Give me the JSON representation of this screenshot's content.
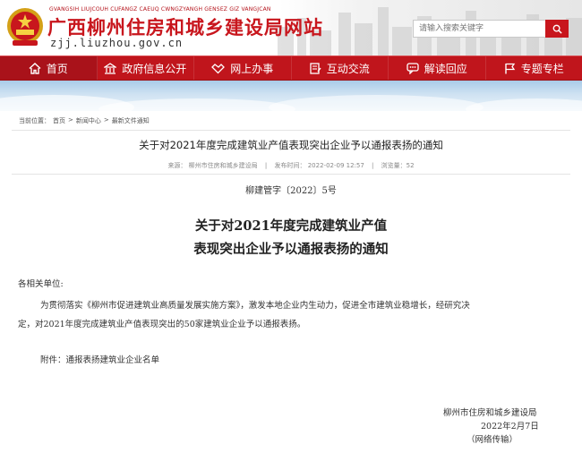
{
  "header": {
    "pinyin": "GVANGSIH LIUJCOUH CUFANGZ CAEUQ CWNGZYANGH GENSEZ GIZ VANGJCAN",
    "site_title": "广西柳州住房和城乡建设局网站",
    "domain": "zjj.liuzhou.gov.cn",
    "search_placeholder": "请输入搜索关键字"
  },
  "nav": {
    "items": [
      {
        "label": "首页",
        "icon": "home-icon"
      },
      {
        "label": "政府信息公开",
        "icon": "building-icon"
      },
      {
        "label": "网上办事",
        "icon": "handshake-icon"
      },
      {
        "label": "互动交流",
        "icon": "document-edit-icon"
      },
      {
        "label": "解读回应",
        "icon": "chat-icon"
      },
      {
        "label": "专题专栏",
        "icon": "flag-icon"
      }
    ]
  },
  "breadcrumb": {
    "prefix": "当前位置：",
    "items": [
      "首页",
      "新闻中心",
      "最新文件通知"
    ],
    "separator": ">"
  },
  "article": {
    "title": "关于对2021年度完成建筑业产值表现突出企业予以通报表扬的通知",
    "source": "来源：  柳州市住房和城乡建设局",
    "time": "发布时间：  2022-02-09 12:57",
    "views": "浏览量：52",
    "doc_number": "柳建管字〔2022〕5号",
    "doc_title_line1": "关于对2021年度完成建筑业产值",
    "doc_title_line2": "表现突出企业予以通报表扬的通知",
    "salutation": "各相关单位:",
    "para1_line1": "为贯彻落实《柳州市促进建筑业高质量发展实施方案》，激发本地企业内生动力，促进全市建筑业稳增长，经研究决",
    "para1_line2": "定，对2021年度完成建筑业产值表现突出的50家建筑业企业予以通报表扬。",
    "attachment": "附件：通报表扬建筑业企业名单",
    "issuer": "柳州市住房和城乡建设局",
    "date": "2022年2月7日",
    "note": "（网络传输）"
  },
  "colors": {
    "brand_red": "#c8161d",
    "nav_red": "#c0151c"
  }
}
